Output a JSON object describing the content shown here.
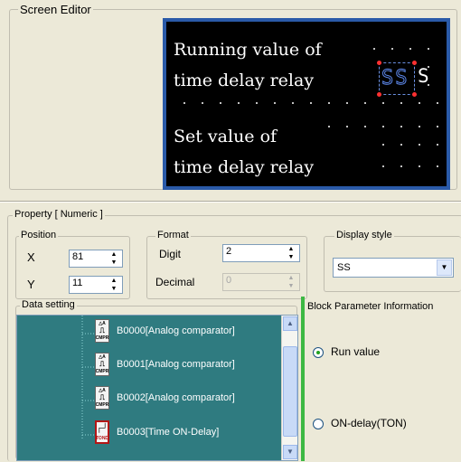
{
  "screen_editor": {
    "title": "Screen Editor",
    "lcd": {
      "line1": "Running value of",
      "line2": "time delay relay",
      "line3": "Set value of",
      "line4": "time delay relay",
      "numeric_field": "SS",
      "numeric_suffix": "S"
    }
  },
  "property": {
    "title": "Property [ Numeric ]",
    "position": {
      "title": "Position",
      "x_label": "X",
      "x_value": "81",
      "y_label": "Y",
      "y_value": "11"
    },
    "format": {
      "title": "Format",
      "digit_label": "Digit",
      "digit_value": "2",
      "decimal_label": "Decimal",
      "decimal_value": "0"
    },
    "display_style": {
      "title": "Display style",
      "selected": "SS"
    }
  },
  "data_setting": {
    "title": "Data setting",
    "items": [
      {
        "label": "B0000[Analog comparator]",
        "icon": "analog-comparator-icon",
        "icon_code": "CMPR"
      },
      {
        "label": "B0001[Analog comparator]",
        "icon": "analog-comparator-icon",
        "icon_code": "CMPR"
      },
      {
        "label": "B0002[Analog comparator]",
        "icon": "analog-comparator-icon",
        "icon_code": "CMPR"
      },
      {
        "label": "B0003[Time ON-Delay]",
        "icon": "on-delay-timer-icon",
        "icon_code": "TOND"
      }
    ]
  },
  "block_parameter": {
    "title": "Block Parameter Information",
    "options": [
      {
        "label": "Run value",
        "selected": true
      },
      {
        "label": "ON-delay(TON)",
        "selected": false
      }
    ]
  },
  "colors": {
    "lcd_border": "#2a5aa8",
    "lcd_bg": "#000000",
    "tree_bg": "#2f7b80",
    "divider_green": "#3cb843",
    "selected_icon_border": "#b31616"
  }
}
